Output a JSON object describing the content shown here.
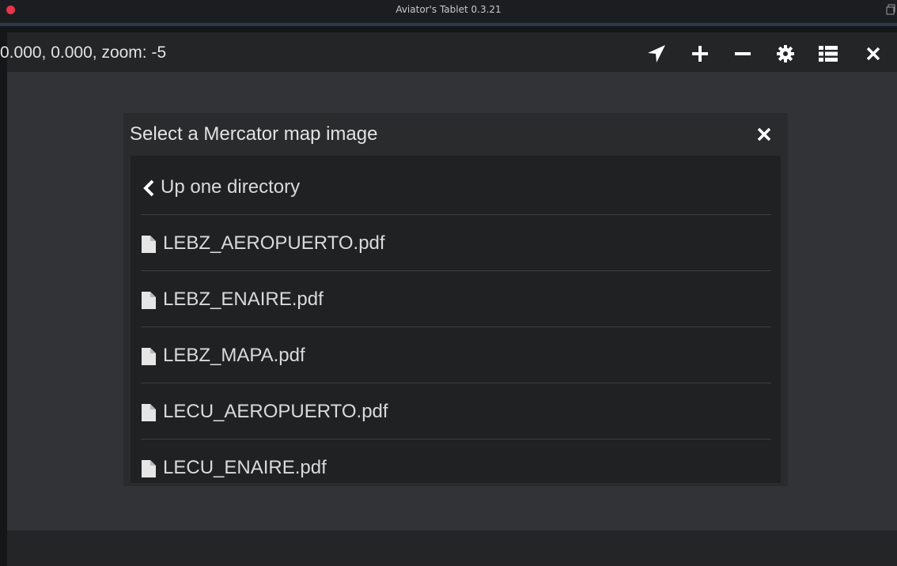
{
  "window": {
    "title": "Aviator's Tablet  0.3.21"
  },
  "toolbar": {
    "coords": "0.000, 0.000, zoom: -5",
    "buttons": [
      {
        "name": "locate-button",
        "icon": "navigation-arrow-icon"
      },
      {
        "name": "zoom-in-button",
        "icon": "plus-icon"
      },
      {
        "name": "zoom-out-button",
        "icon": "minus-icon"
      },
      {
        "name": "settings-button",
        "icon": "gear-icon"
      },
      {
        "name": "list-button",
        "icon": "list-icon"
      },
      {
        "name": "close-button",
        "icon": "close-icon"
      }
    ]
  },
  "dialog": {
    "title": "Select a Mercator map image",
    "up_label": "Up one directory",
    "files": [
      "LEBZ_AEROPUERTO.pdf",
      "LEBZ_ENAIRE.pdf",
      "LEBZ_MAPA.pdf",
      "LECU_AEROPUERTO.pdf",
      "LECU_ENAIRE.pdf"
    ]
  },
  "colors": {
    "accent_close_dot": "#e8334a",
    "panel_bg": "#333436",
    "toolbar_bg": "#242527",
    "text": "#e2e2e2"
  }
}
